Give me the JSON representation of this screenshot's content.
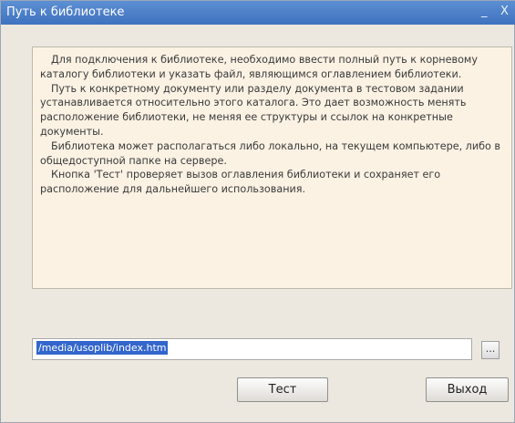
{
  "window": {
    "title": "Путь к библиотеке",
    "minimize_glyph": "_",
    "close_glyph": "X"
  },
  "description": {
    "paragraphs": [
      "Для подключения к библиотеке, необходимо ввести полный путь к корневому каталогу библиотеки и указать файл, являющимся оглавлением библиотеки.",
      "Путь к конкретному документу или разделу документа в тестовом задании устанавливается относительно этого каталога. Это дает возможность менять расположение библиотеки, не меняя ее структуры и ссылок на конкретные документы.",
      "Библиотека может располагаться либо локально, на текущем компьютере, либо в общедоступной папке на сервере.",
      "Кнопка 'Тест' проверяет вызов оглавления библиотеки и сохраняет его расположение для дальнейшего использования."
    ]
  },
  "path_field": {
    "value": "/media/usoplib/index.htm"
  },
  "browse_button": {
    "label": "..."
  },
  "buttons": {
    "test_label": "Тест",
    "exit_label": "Выход"
  },
  "colors": {
    "titlebar": "#4a7dc8",
    "description_background": "#fbf2e4",
    "selection": "#3366cc",
    "window_background": "#ece8df"
  }
}
